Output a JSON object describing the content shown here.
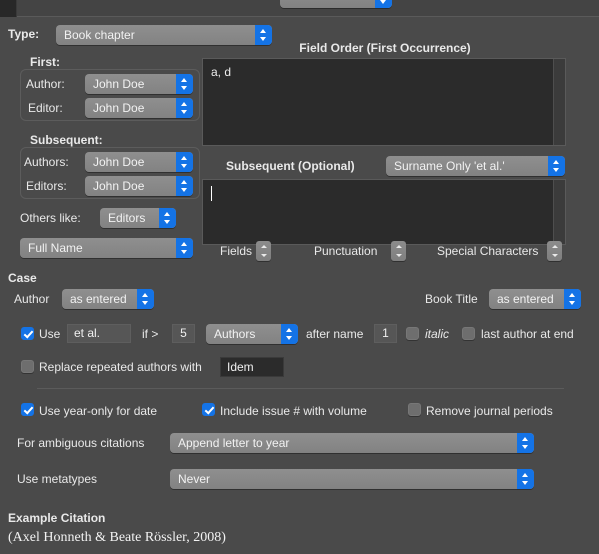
{
  "window": {
    "background_color": "#4a4a4a",
    "accent_color": "#1473e6"
  },
  "top_clipped_row": {
    "label": "",
    "popup_value": ""
  },
  "type_row": {
    "label": "Type:",
    "value": "Book chapter"
  },
  "first": {
    "group_label": "First:",
    "author": {
      "label": "Author:",
      "value": "John Doe"
    },
    "editor": {
      "label": "Editor:",
      "value": "John Doe"
    }
  },
  "subsequent": {
    "group_label": "Subsequent:",
    "authors": {
      "label": "Authors:",
      "value": "John Doe"
    },
    "editors": {
      "label": "Editors:",
      "value": "John Doe"
    }
  },
  "others_like": {
    "label": "Others like:",
    "value": "Editors"
  },
  "name_format": {
    "value": "Full Name"
  },
  "field_order": {
    "title": "Field Order (First Occurrence)",
    "text": "a, d"
  },
  "subsequent_optional": {
    "title": "Subsequent (Optional)",
    "popup_value": "Surname Only  'et al.'",
    "text": ""
  },
  "inserters": [
    {
      "label": "Fields"
    },
    {
      "label": "Punctuation"
    },
    {
      "label": "Special Characters"
    }
  ],
  "case_section": {
    "heading": "Case",
    "author": {
      "label": "Author",
      "value": "as entered"
    },
    "book_title": {
      "label": "Book Title",
      "value": "as entered"
    }
  },
  "etal_row": {
    "use_label": "Use",
    "use_checked": true,
    "etal_text": "et al.",
    "if_label": "if >",
    "if_value": "5",
    "unit_value": "Authors",
    "after_name_label": "after name",
    "after_name_value": "1",
    "italic_label": "italic",
    "italic_checked": false,
    "last_author_label": "last author at end",
    "last_author_checked": false
  },
  "replace_row": {
    "checked": false,
    "label": "Replace repeated authors with",
    "value": "Idem"
  },
  "options_row": {
    "year_only": {
      "label": "Use year-only for date",
      "checked": true
    },
    "issue_with_volume": {
      "label": "Include issue # with volume",
      "checked": true
    },
    "remove_journal_periods": {
      "label": "Remove journal periods",
      "checked": false
    }
  },
  "ambiguous": {
    "label": "For ambiguous citations",
    "value": "Append letter to year"
  },
  "metatypes": {
    "label": "Use metatypes",
    "value": "Never"
  },
  "example": {
    "heading": "Example Citation",
    "citation": "(Axel Honneth & Beate Rössler, 2008)"
  }
}
